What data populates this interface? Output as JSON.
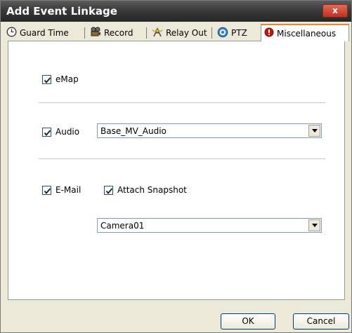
{
  "window": {
    "title": "Add Event Linkage",
    "close_glyph": "x"
  },
  "tabs": [
    {
      "label": "Guard Time",
      "icon": "clock-icon"
    },
    {
      "label": "Record",
      "icon": "camera-icon"
    },
    {
      "label": "Relay Out",
      "icon": "relay-icon"
    },
    {
      "label": "PTZ",
      "icon": "ptz-icon"
    },
    {
      "label": "Miscellaneous",
      "icon": "alert-icon",
      "active": true
    }
  ],
  "miscellaneous": {
    "emap": {
      "label": "eMap",
      "checked": true
    },
    "audio": {
      "label": "Audio",
      "checked": true,
      "selected": "Base_MV_Audio"
    },
    "email": {
      "label": "E-Mail",
      "checked": true
    },
    "attach_snapshot": {
      "label": "Attach Snapshot",
      "checked": true
    },
    "camera": {
      "selected": "Camera01"
    }
  },
  "buttons": {
    "ok": "OK",
    "cancel": "Cancel"
  }
}
